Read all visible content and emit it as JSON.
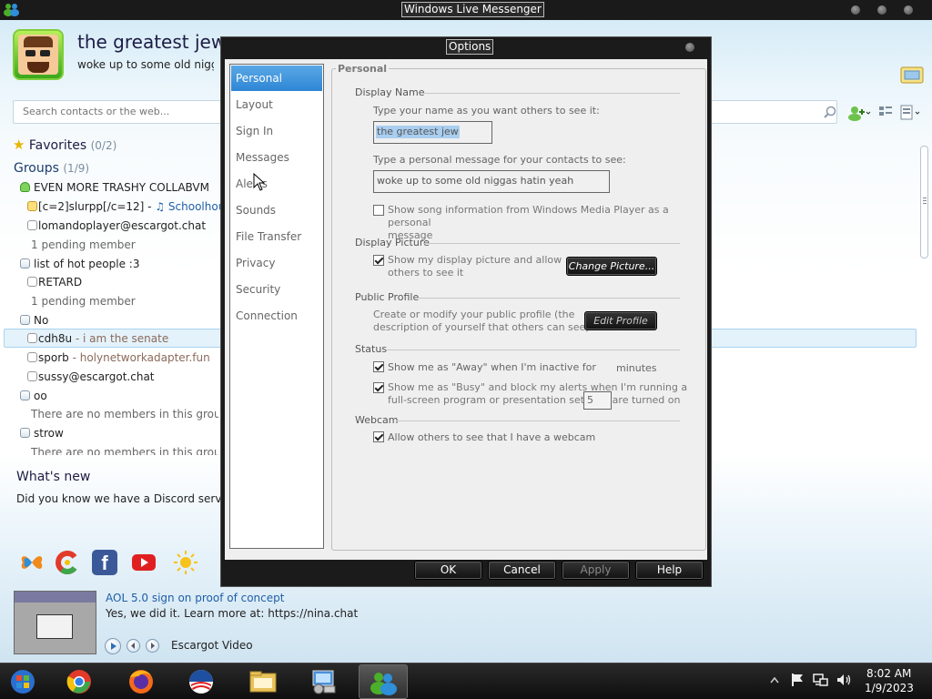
{
  "window": {
    "title": "Windows Live Messenger"
  },
  "profile": {
    "display_name": "the greatest jew",
    "personal_message": "woke up to some old niggas hatin yeah"
  },
  "search": {
    "placeholder": "Search contacts or the web..."
  },
  "favorites": {
    "label": "Favorites",
    "count": "(0/2)"
  },
  "groups": {
    "label": "Groups",
    "count": "(1/9)"
  },
  "contact_list": {
    "g1": {
      "name": "EVEN MORE TRASHY COLLABVM",
      "contact1_name": "[c=2]slurpp[/c=12]",
      "contact1_sep": " - ",
      "contact1_music": "Schoolhouse",
      "contact2": "lomandoplayer@escargot.chat",
      "pending": "1 pending member"
    },
    "g2": {
      "name": "list of hot people :3",
      "contact1": "RETARD",
      "pending": "1 pending member"
    },
    "g3": {
      "name": "No",
      "contact1_name": "cdh8u",
      "contact1_msg": " - i am the senate",
      "contact2_name": "sporb",
      "contact2_msg": " - holynetworkadapter.fun",
      "contact3": "sussy@escargot.chat"
    },
    "g4": {
      "name": "oo",
      "empty": "There are no members in this group."
    },
    "g5": {
      "name": "strow",
      "empty": "There are no members in this group."
    }
  },
  "whats_new": {
    "label": "What's new",
    "text": "Did you know we have a Discord server? Join"
  },
  "video": {
    "title": "AOL 5.0 sign on proof of concept",
    "description": "Yes, we did it. Learn more at: https://nina.chat",
    "source": "Escargot Video"
  },
  "dialog": {
    "title": "Options",
    "nav": [
      "Personal",
      "Layout",
      "Sign In",
      "Messages",
      "Alerts",
      "Sounds",
      "File Transfer",
      "Privacy",
      "Security",
      "Connection"
    ],
    "panel_title": "Personal",
    "display_name": {
      "header": "Display Name",
      "name_label": "Type your name as you want others to see it:",
      "name_value": "the greatest jew",
      "msg_label": "Type a personal message for your contacts to see:",
      "msg_value": "woke up to some old niggas hatin yeah",
      "song_line1": "Show song information from Windows Media Player as a personal",
      "song_line2": "message"
    },
    "display_picture": {
      "header": "Display Picture",
      "show_line1": "Show my display picture and allow",
      "show_line2": "others to see it",
      "change_button": "Change Picture..."
    },
    "public_profile": {
      "header": "Public Profile",
      "line1": "Create or modify your public profile (the",
      "line2": "description of yourself that others can see)",
      "edit_button": "Edit Profile"
    },
    "status": {
      "header": "Status",
      "away_label": "Show me as \"Away\" when I'm inactive for",
      "away_minutes": "5",
      "minutes_label": "minutes",
      "busy_line1": "Show me as \"Busy\" and block my alerts when I'm running a",
      "busy_line2": "full-screen program or presentation settings are turned on"
    },
    "webcam": {
      "header": "Webcam",
      "allow_label": "Allow others to see that I have a webcam"
    },
    "buttons": {
      "ok": "OK",
      "cancel": "Cancel",
      "apply": "Apply",
      "help": "Help"
    }
  },
  "taskbar": {
    "time": "8:02 AM",
    "date": "1/9/2023"
  },
  "colors": {
    "accent": "#2e86d4",
    "link": "#1f5ea8",
    "dialog_frame": "#1b1b1b"
  }
}
